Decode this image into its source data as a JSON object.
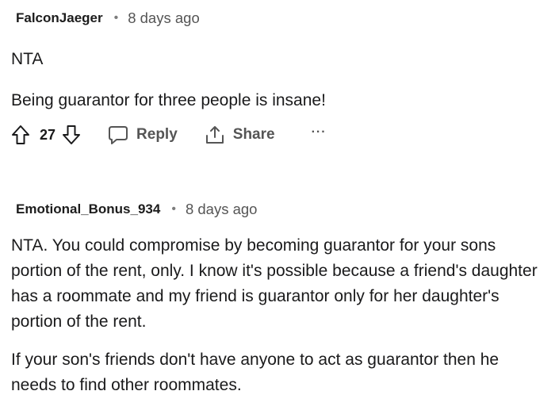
{
  "comments": [
    {
      "author": "FalconJaeger",
      "separator": "•",
      "time": "8 days ago",
      "paragraphs": [
        "NTA",
        "Being guarantor for three people is insane!"
      ],
      "votes": "27",
      "reply_label": "Reply",
      "share_label": "Share",
      "more_label": "···"
    },
    {
      "author": "Emotional_Bonus_934",
      "separator": "•",
      "time": "8 days ago",
      "paragraphs": [
        "NTA. You could compromise by becoming guarantor for your sons portion of the rent, only. I know it's possible because a friend's daughter has a roommate and my friend is guarantor only for her daughter's portion of the rent.",
        "If your son's friends don't have anyone to act as guarantor then he needs to find other roommates."
      ]
    }
  ],
  "icons": {
    "upvote": "arrow-up-outline",
    "downvote": "arrow-down-outline",
    "reply": "speech-bubble",
    "share": "share-upload"
  }
}
